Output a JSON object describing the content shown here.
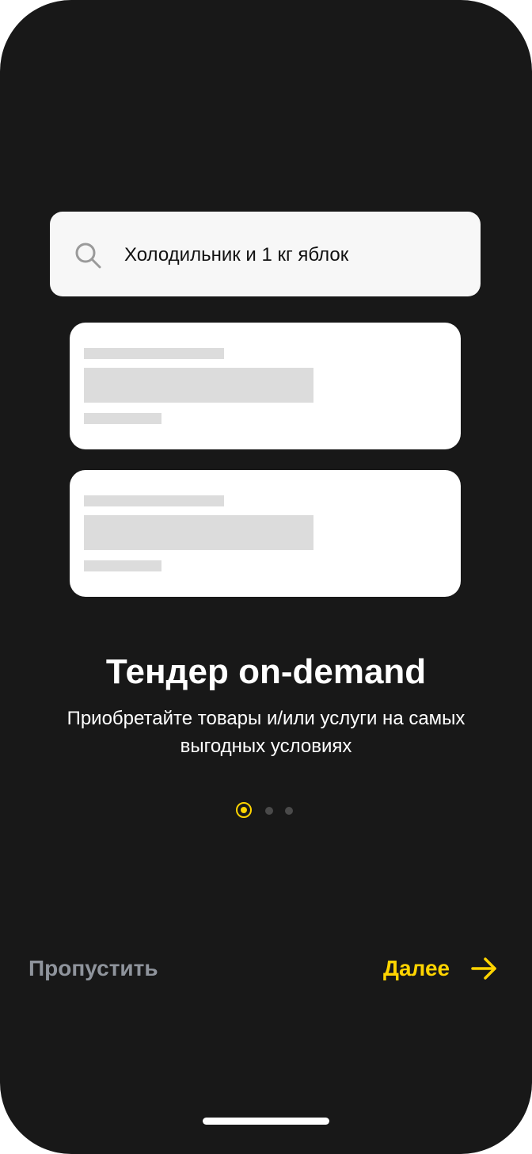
{
  "search": {
    "query": "Холодильник и 1 кг яблок",
    "icon": "search-icon"
  },
  "onboarding": {
    "title": "Тендер on-demand",
    "subtitle_line1": "Приобретайте товары и/или услуги на самых",
    "subtitle_line2": "выгодных условиях",
    "page_current": 1,
    "page_total": 3
  },
  "footer": {
    "skip_label": "Пропустить",
    "next_label": "Далее",
    "next_icon": "arrow-right-icon"
  },
  "colors": {
    "background": "#181818",
    "accent": "#ffd400",
    "muted": "#8f949c",
    "card": "#ffffff",
    "skeleton": "#dcdcdc"
  }
}
